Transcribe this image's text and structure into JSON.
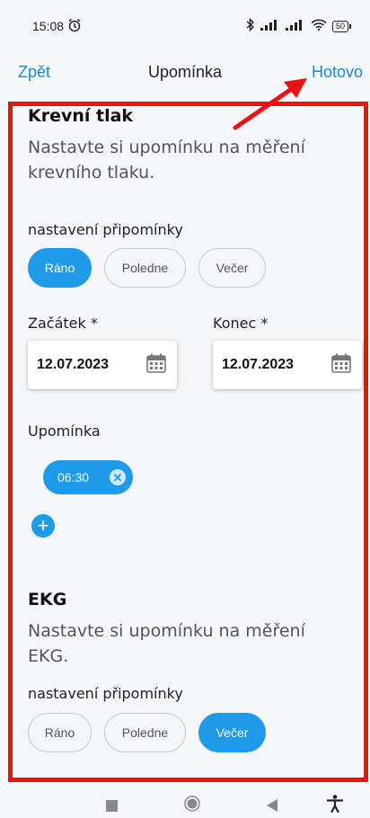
{
  "status_bar": {
    "time": "15:08",
    "alarm_icon": "alarm-clock-icon",
    "bluetooth_icon": "bluetooth-icon",
    "signal_icon": "signal-bars-icon",
    "wifi_icon": "wifi-icon",
    "battery": "50"
  },
  "nav": {
    "back": "Zpět",
    "title": "Upomínka",
    "done": "Hotovo"
  },
  "section_blood_pressure": {
    "title": "Krevní tlak",
    "description": "Nastavte si upomínku na měření krevního tlaku.",
    "settings_label": "nastavení připomínky",
    "options": [
      "Ráno",
      "Poledne",
      "Večer"
    ],
    "selected": "Ráno",
    "start_label": "Začátek *",
    "start_value": "12.07.2023",
    "end_label": "Konec *",
    "end_value": "12.07.2023",
    "reminder_label": "Upomínka",
    "reminder_time": "06:30"
  },
  "section_ekg": {
    "title": "EKG",
    "description": "Nastavte si upomínku na měření EKG.",
    "settings_label": "nastavení připomínky",
    "options": [
      "Ráno",
      "Poledne",
      "Večer"
    ],
    "selected": "Večer"
  },
  "colors": {
    "accent": "#1e9be8",
    "link": "#1a8ad6",
    "highlight": "#ee1111"
  }
}
